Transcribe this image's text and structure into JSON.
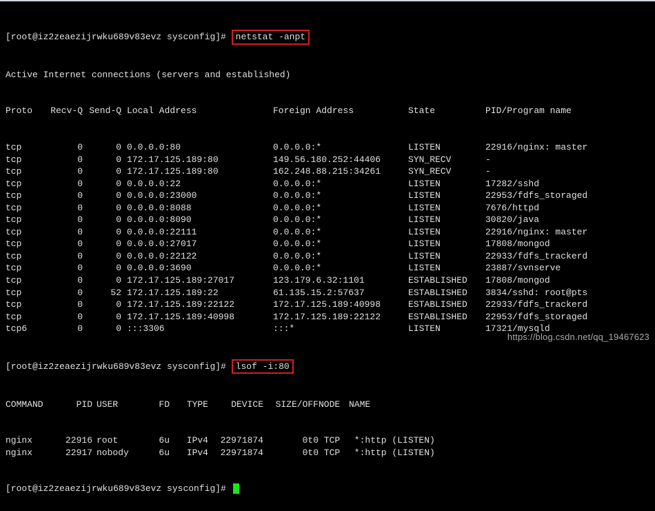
{
  "prompt": "[root@iz2zeaezijrwku689v83evz sysconfig]#",
  "cmd1": "netstat -anpt",
  "active_line": "Active Internet connections (servers and established)",
  "netstat_headers": {
    "proto": "Proto",
    "recvq": "Recv-Q",
    "sendq": "Send-Q",
    "local": "Local Address",
    "foreign": "Foreign Address",
    "state": "State",
    "pid": "PID/Program name"
  },
  "netstat_rows": [
    {
      "proto": "tcp",
      "recvq": "0",
      "sendq": "0",
      "local": "0.0.0.0:80",
      "foreign": "0.0.0.0:*",
      "state": "LISTEN",
      "pid": "22916/nginx: master"
    },
    {
      "proto": "tcp",
      "recvq": "0",
      "sendq": "0",
      "local": "172.17.125.189:80",
      "foreign": "149.56.180.252:44406",
      "state": "SYN_RECV",
      "pid": "-"
    },
    {
      "proto": "tcp",
      "recvq": "0",
      "sendq": "0",
      "local": "172.17.125.189:80",
      "foreign": "162.248.88.215:34261",
      "state": "SYN_RECV",
      "pid": "-"
    },
    {
      "proto": "tcp",
      "recvq": "0",
      "sendq": "0",
      "local": "0.0.0.0:22",
      "foreign": "0.0.0.0:*",
      "state": "LISTEN",
      "pid": "17282/sshd"
    },
    {
      "proto": "tcp",
      "recvq": "0",
      "sendq": "0",
      "local": "0.0.0.0:23000",
      "foreign": "0.0.0.0:*",
      "state": "LISTEN",
      "pid": "22953/fdfs_storaged"
    },
    {
      "proto": "tcp",
      "recvq": "0",
      "sendq": "0",
      "local": "0.0.0.0:8088",
      "foreign": "0.0.0.0:*",
      "state": "LISTEN",
      "pid": "7676/httpd"
    },
    {
      "proto": "tcp",
      "recvq": "0",
      "sendq": "0",
      "local": "0.0.0.0:8090",
      "foreign": "0.0.0.0:*",
      "state": "LISTEN",
      "pid": "30820/java"
    },
    {
      "proto": "tcp",
      "recvq": "0",
      "sendq": "0",
      "local": "0.0.0.0:22111",
      "foreign": "0.0.0.0:*",
      "state": "LISTEN",
      "pid": "22916/nginx: master"
    },
    {
      "proto": "tcp",
      "recvq": "0",
      "sendq": "0",
      "local": "0.0.0.0:27017",
      "foreign": "0.0.0.0:*",
      "state": "LISTEN",
      "pid": "17808/mongod"
    },
    {
      "proto": "tcp",
      "recvq": "0",
      "sendq": "0",
      "local": "0.0.0.0:22122",
      "foreign": "0.0.0.0:*",
      "state": "LISTEN",
      "pid": "22933/fdfs_trackerd"
    },
    {
      "proto": "tcp",
      "recvq": "0",
      "sendq": "0",
      "local": "0.0.0.0:3690",
      "foreign": "0.0.0.0:*",
      "state": "LISTEN",
      "pid": "23887/svnserve"
    },
    {
      "proto": "tcp",
      "recvq": "0",
      "sendq": "0",
      "local": "172.17.125.189:27017",
      "foreign": "123.179.6.32:1101",
      "state": "ESTABLISHED",
      "pid": "17808/mongod"
    },
    {
      "proto": "tcp",
      "recvq": "0",
      "sendq": "52",
      "local": "172.17.125.189:22",
      "foreign": "61.135.15.2:57637",
      "state": "ESTABLISHED",
      "pid": "3834/sshd: root@pts"
    },
    {
      "proto": "tcp",
      "recvq": "0",
      "sendq": "0",
      "local": "172.17.125.189:22122",
      "foreign": "172.17.125.189:40998",
      "state": "ESTABLISHED",
      "pid": "22933/fdfs_trackerd"
    },
    {
      "proto": "tcp",
      "recvq": "0",
      "sendq": "0",
      "local": "172.17.125.189:40998",
      "foreign": "172.17.125.189:22122",
      "state": "ESTABLISHED",
      "pid": "22953/fdfs_storaged"
    },
    {
      "proto": "tcp6",
      "recvq": "0",
      "sendq": "0",
      "local": ":::3306",
      "foreign": ":::*",
      "state": "LISTEN",
      "pid": "17321/mysqld"
    }
  ],
  "cmd2": "lsof -i:80",
  "lsof_headers": {
    "cmd": "COMMAND",
    "pid": "PID",
    "user": "USER",
    "fd": "FD",
    "type": "TYPE",
    "dev": "DEVICE",
    "size": "SIZE/OFF",
    "node": "NODE",
    "name": "NAME"
  },
  "lsof_rows": [
    {
      "cmd": "nginx",
      "pid": "22916",
      "user": "root",
      "fd": "6u",
      "type": "IPv4",
      "dev": "22971874",
      "size": "0t0",
      "node": "TCP",
      "name": "*:http (LISTEN)"
    },
    {
      "cmd": "nginx",
      "pid": "22917",
      "user": "nobody",
      "fd": "6u",
      "type": "IPv4",
      "dev": "22971874",
      "size": "0t0",
      "node": "TCP",
      "name": "*:http (LISTEN)"
    }
  ],
  "watermark": "https://blog.csdn.net/qq_19467623"
}
